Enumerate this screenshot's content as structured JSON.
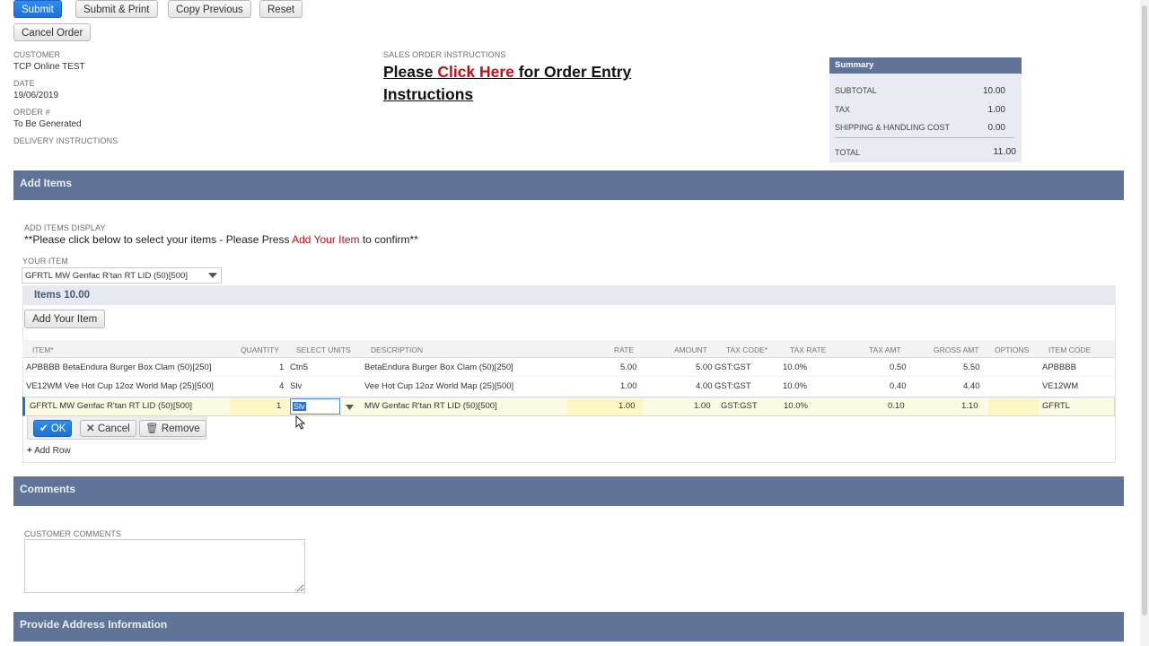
{
  "toolbar": {
    "submit": "Submit",
    "submit_print": "Submit & Print",
    "copy_previous": "Copy Previous",
    "reset": "Reset",
    "cancel_order": "Cancel Order"
  },
  "customer": {
    "label": "CUSTOMER",
    "value": "TCP Online TEST"
  },
  "date": {
    "label": "DATE",
    "value": "19/06/2019"
  },
  "order": {
    "label": "ORDER #",
    "value": "To Be Generated"
  },
  "delivery": {
    "label": "DELIVERY INSTRUCTIONS"
  },
  "instructions": {
    "label": "SALES ORDER INSTRUCTIONS",
    "line1_a": "Please ",
    "line1_link": "Click Here",
    "line1_b": " for Order Entry",
    "line2": "Instructions"
  },
  "summary": {
    "title": "Summary",
    "subtotal_label": "SUBTOTAL",
    "subtotal": "10.00",
    "tax_label": "TAX",
    "tax": "1.00",
    "shipping_label": "SHIPPING & HANDLING COST",
    "shipping": "0.00",
    "total_label": "TOTAL",
    "total": "11.00"
  },
  "sections": {
    "add_items": "Add Items",
    "comments": "Comments",
    "address": "Provide Address Information"
  },
  "add_items": {
    "display_label": "ADD ITEMS DISPLAY",
    "instr_a": "**Please click below to select your items - Please Press ",
    "instr_link": "Add Your Item",
    "instr_b": " to confirm**",
    "your_item_label": "YOUR ITEM",
    "your_item_value": "GFRTL MW Genfac R'tan RT  LID (50)[500]",
    "items_title": "Items 10.00",
    "add_your_item": "Add Your Item"
  },
  "columns": {
    "item": "ITEM",
    "quantity": "QUANTITY",
    "units": "SELECT UNITS",
    "description": "DESCRIPTION",
    "rate": "RATE",
    "amount": "AMOUNT",
    "tax_code": "TAX CODE",
    "tax_rate": "TAX RATE",
    "tax_amt": "TAX AMT",
    "gross_amt": "GROSS AMT",
    "options": "OPTIONS",
    "item_code": "ITEM CODE"
  },
  "rows": [
    {
      "item": "APBBBB BetaEndura Burger Box Clam (50)[250]",
      "qty": "1",
      "units": "Ctn5",
      "desc": "BetaEndura Burger Box Clam (50)[250]",
      "rate": "5.00",
      "amount": "5.00",
      "tax_code": "GST:GST",
      "tax_rate": "10.0%",
      "tax_amt": "0.50",
      "gross": "5.50",
      "code": "APBBBB"
    },
    {
      "item": "VE12WM Vee Hot Cup 12oz World Map (25)[500]",
      "qty": "4",
      "units": "Slv",
      "desc": "Vee Hot Cup 12oz World Map (25)[500]",
      "rate": "1.00",
      "amount": "4.00",
      "tax_code": "GST:GST",
      "tax_rate": "10.0%",
      "tax_amt": "0.40",
      "gross": "4.40",
      "code": "VE12WM"
    },
    {
      "item": "GFRTL MW Genfac R'tan RT LID (50)[500]",
      "qty": "1",
      "units": "Slv",
      "desc": "MW Genfac R'tan RT LID (50)[500]",
      "rate": "1.00",
      "amount": "1.00",
      "tax_code": "GST:GST",
      "tax_rate": "10.0%",
      "tax_amt": "0.10",
      "gross": "1.10",
      "code": "GFRTL"
    }
  ],
  "row_actions": {
    "ok": "OK",
    "cancel": "Cancel",
    "remove": "Remove",
    "add_row": "Add Row"
  },
  "comments": {
    "label": "CUSTOMER COMMENTS",
    "value": ""
  },
  "colors": {
    "primary": "#1f6fd4",
    "section": "#5f7497",
    "link": "#c0101a",
    "edit_row": "#fbfbe4"
  }
}
